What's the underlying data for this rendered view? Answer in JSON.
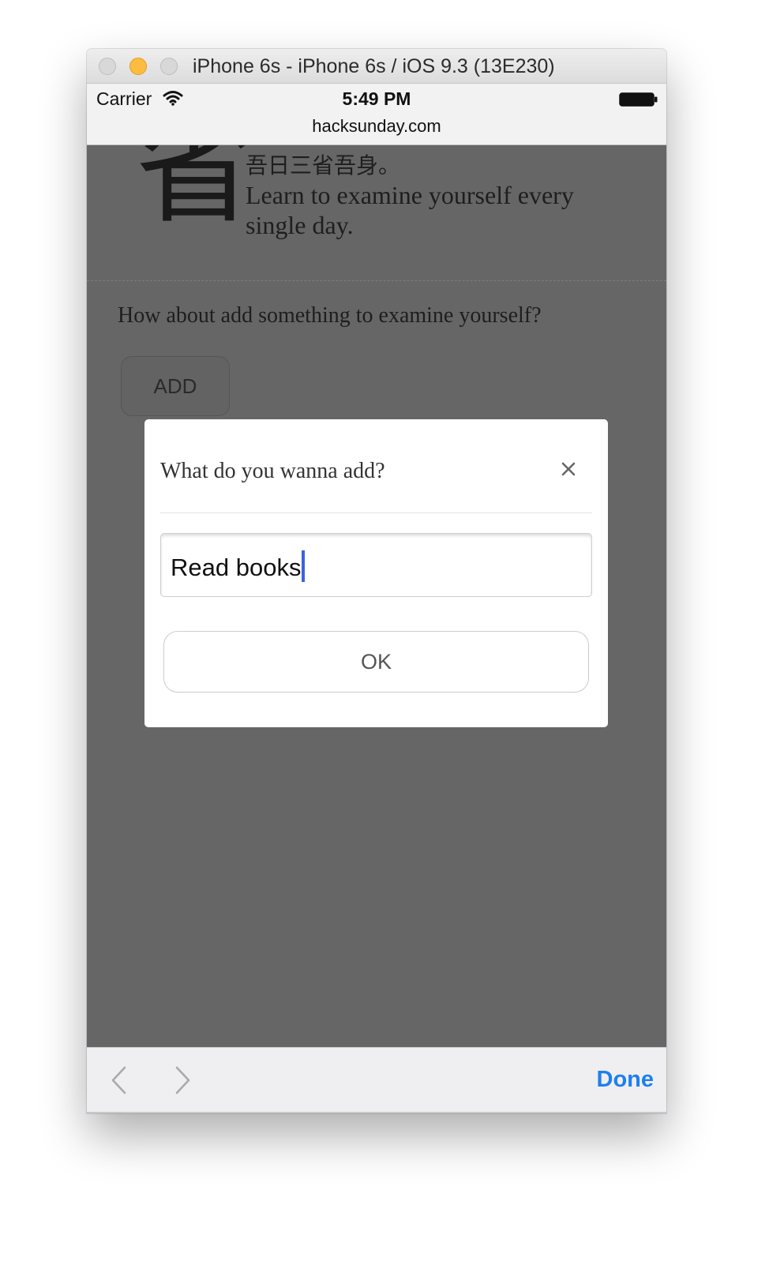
{
  "window": {
    "title": "iPhone 6s - iPhone 6s / iOS 9.3 (13E230)"
  },
  "status_bar": {
    "carrier": "Carrier",
    "time": "5:49 PM",
    "url": "hacksunday.com"
  },
  "page": {
    "big_character": "省",
    "quote_chinese": "吾日三省吾身。",
    "quote_english": "Learn to examine yourself every single day.",
    "prompt": "How about add something to examine yourself?",
    "add_button": "ADD"
  },
  "modal": {
    "title": "What do you wanna add?",
    "close_glyph": "×",
    "input_value": "Read books",
    "ok_button": "OK"
  },
  "keyboard_toolbar": {
    "done_label": "Done"
  },
  "colors": {
    "overlay": "#666666",
    "accent": "#1f7ff0",
    "caret": "#3b62e0",
    "minimize_button": "#fdbb40"
  }
}
